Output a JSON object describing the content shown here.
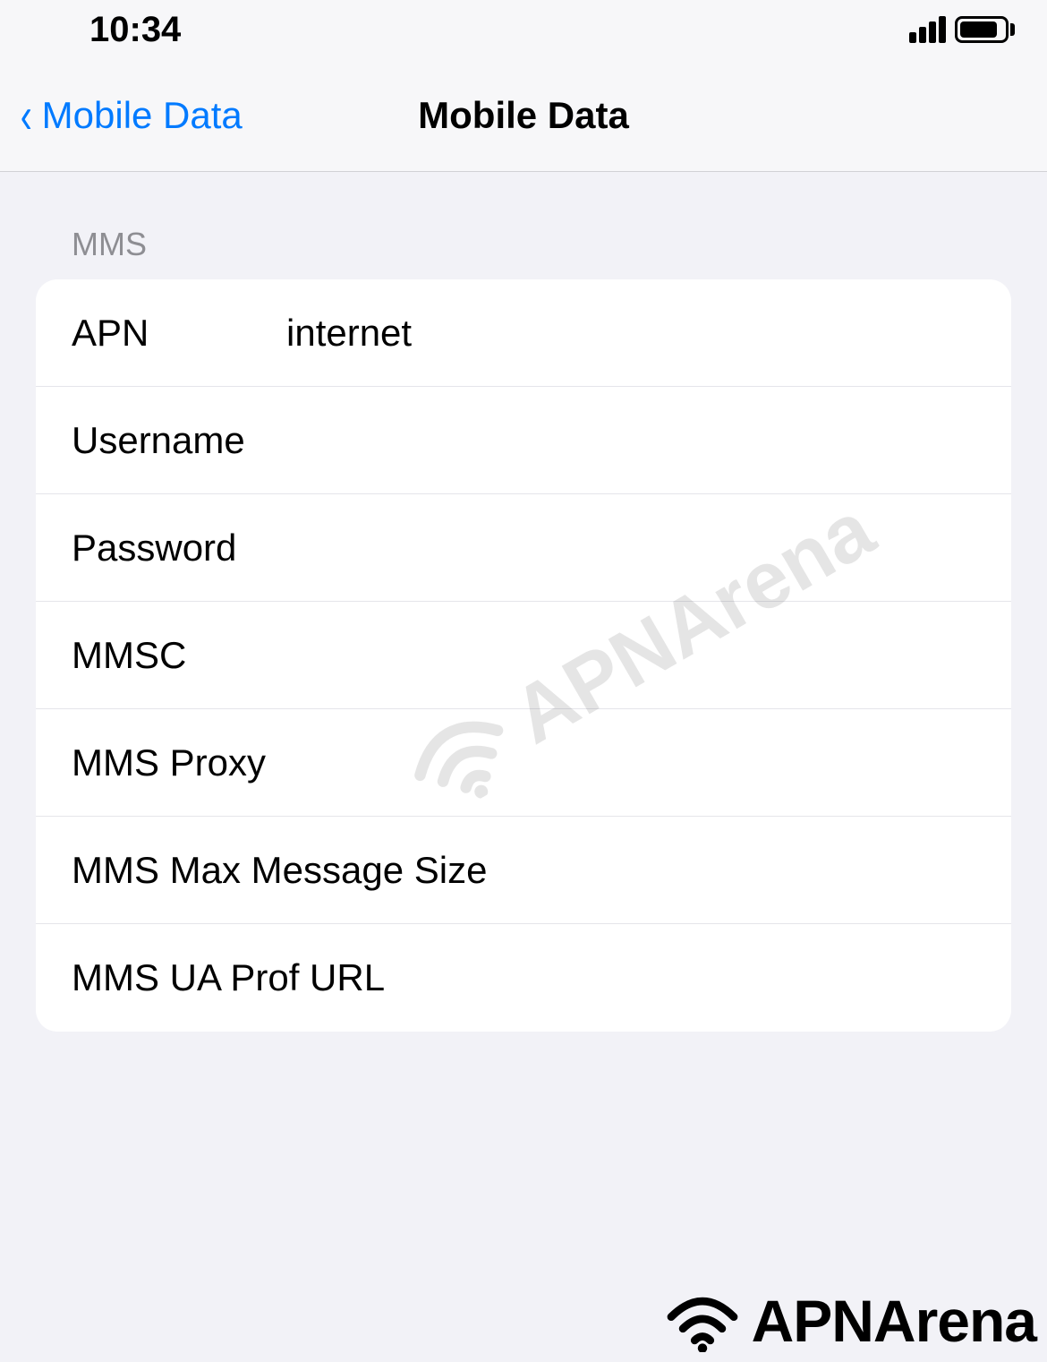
{
  "status_bar": {
    "time": "10:34"
  },
  "nav": {
    "back_label": "Mobile Data",
    "title": "Mobile Data"
  },
  "mms": {
    "section_header": "MMS",
    "rows": {
      "apn": {
        "label": "APN",
        "value": "internet"
      },
      "username": {
        "label": "Username",
        "value": ""
      },
      "password": {
        "label": "Password",
        "value": ""
      },
      "mmsc": {
        "label": "MMSC",
        "value": ""
      },
      "proxy": {
        "label": "MMS Proxy",
        "value": ""
      },
      "max_size": {
        "label": "MMS Max Message Size",
        "value": ""
      },
      "ua_prof": {
        "label": "MMS UA Prof URL",
        "value": ""
      }
    }
  },
  "watermark": {
    "brand": "APNArena"
  }
}
